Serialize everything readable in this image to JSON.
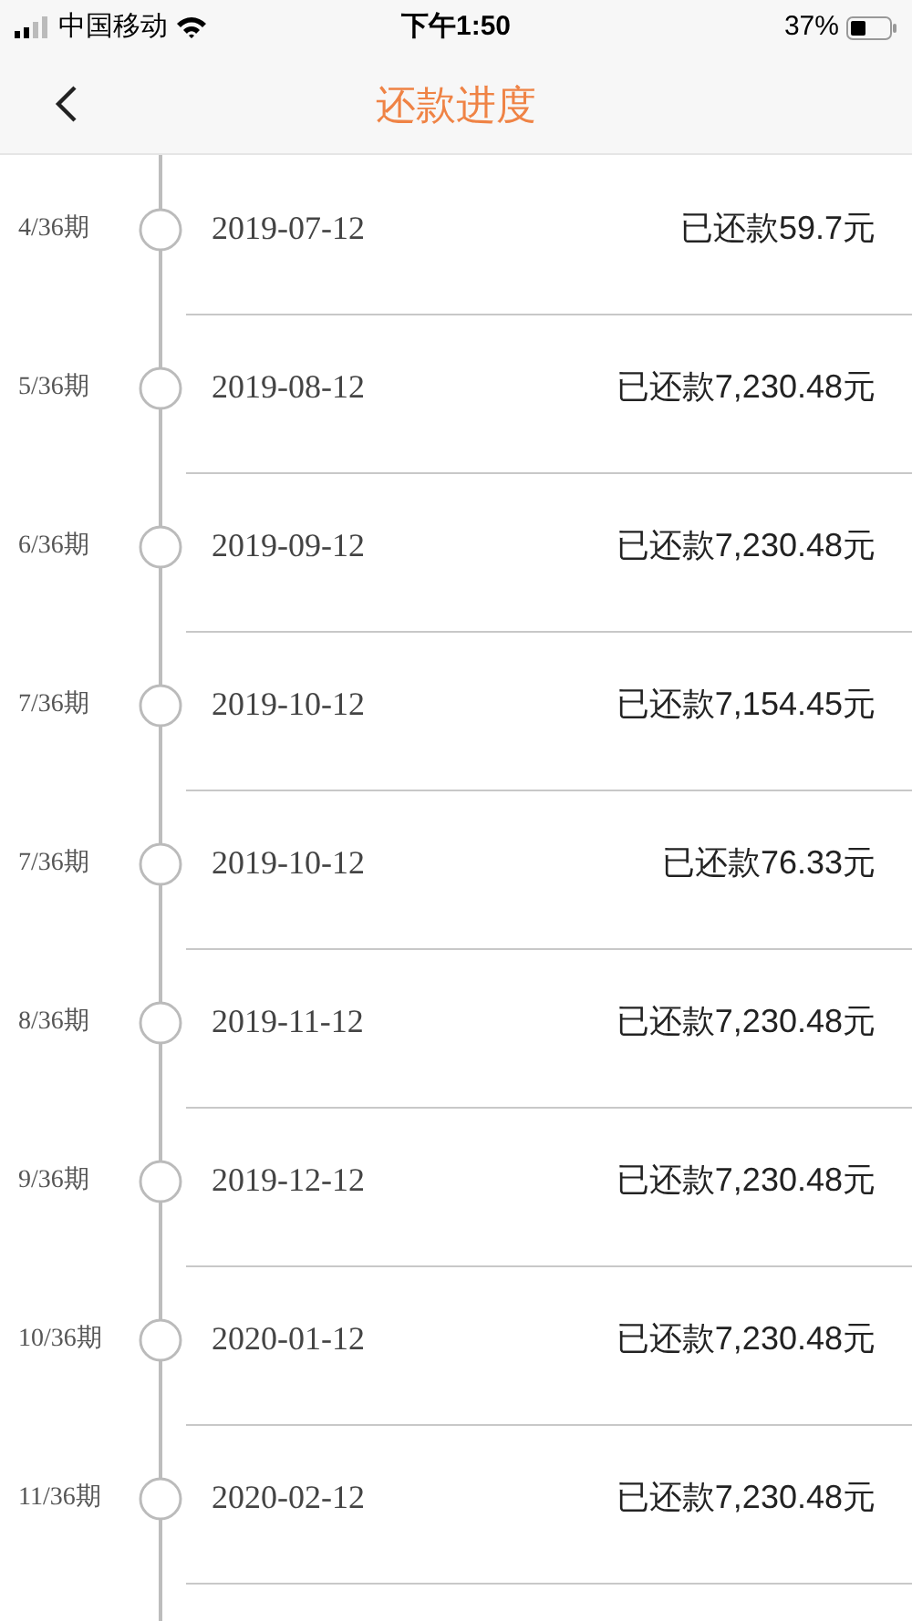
{
  "status_bar": {
    "carrier": "中国移动",
    "time": "下午1:50",
    "battery": "37%"
  },
  "header": {
    "title": "还款进度"
  },
  "rows": [
    {
      "period": "4/36期",
      "date": "2019-07-12",
      "amount": "已还款59.7元"
    },
    {
      "period": "5/36期",
      "date": "2019-08-12",
      "amount": "已还款7,230.48元"
    },
    {
      "period": "6/36期",
      "date": "2019-09-12",
      "amount": "已还款7,230.48元"
    },
    {
      "period": "7/36期",
      "date": "2019-10-12",
      "amount": "已还款7,154.45元"
    },
    {
      "period": "7/36期",
      "date": "2019-10-12",
      "amount": "已还款76.33元"
    },
    {
      "period": "8/36期",
      "date": "2019-11-12",
      "amount": "已还款7,230.48元"
    },
    {
      "period": "9/36期",
      "date": "2019-12-12",
      "amount": "已还款7,230.48元"
    },
    {
      "period": "10/36期",
      "date": "2020-01-12",
      "amount": "已还款7,230.48元"
    },
    {
      "period": "11/36期",
      "date": "2020-02-12",
      "amount": "已还款7,230.48元"
    }
  ]
}
